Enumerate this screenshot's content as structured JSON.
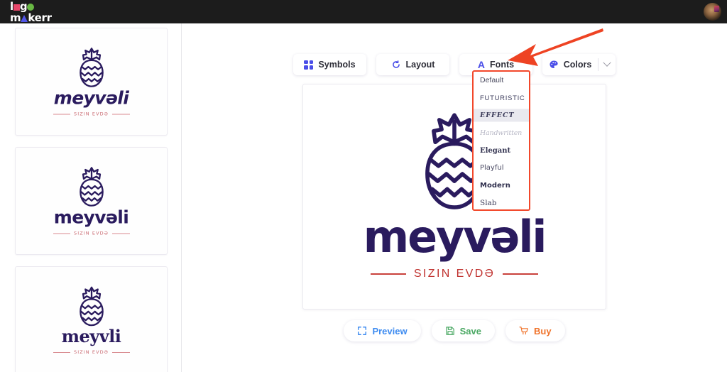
{
  "topbar": {
    "brand_line1_a": "l",
    "brand_line1_sq": "square-icon",
    "brand_line1_b": "g",
    "brand_line1_circle": "circle-icon",
    "brand_line2_a": "m",
    "brand_line2_tri": "triangle-icon",
    "brand_line2_b": "kerr",
    "brand_full": "logomakerr",
    "avatar_name": "user-avatar",
    "background_color": "#1c1c1c"
  },
  "sidebar": {
    "thumbnails": [
      {
        "name": "meyvəli",
        "tagline": "SIZIN EVDƏ",
        "style": "italic",
        "symbol": "pineapple-icon"
      },
      {
        "name": "meyvəli",
        "tagline": "SIZIN EVDƏ",
        "style": "regular",
        "symbol": "pineapple-icon"
      },
      {
        "name": "meyvli",
        "tagline": "SIZIN EVDƏ",
        "style": "serif",
        "symbol": "pineapple-icon"
      }
    ]
  },
  "toolbar": {
    "buttons": [
      {
        "label": "Symbols",
        "icon": "grid-dots-icon",
        "has_caret": false
      },
      {
        "label": "Layout",
        "icon": "layout-refresh-icon",
        "has_caret": false
      },
      {
        "label": "Fonts",
        "icon": "letter-a-icon",
        "has_caret": true,
        "active": true
      },
      {
        "label": "Colors",
        "icon": "palette-icon",
        "has_caret": true
      }
    ],
    "caret_icon": "chevron-down-icon"
  },
  "fonts_dropdown": {
    "open": true,
    "highlight_color": "#f2482b",
    "options": [
      {
        "label": "Default",
        "style_key": "dd-default"
      },
      {
        "label": "FUTURISTIC",
        "style_key": "dd-futuristic"
      },
      {
        "label": "EFFECT",
        "style_key": "dd-effect"
      },
      {
        "label": "Handwritten",
        "style_key": "dd-hand"
      },
      {
        "label": "Elegant",
        "style_key": "dd-elegant"
      },
      {
        "label": "Playful",
        "style_key": "dd-playful"
      },
      {
        "label": "Modern",
        "style_key": "dd-modern"
      },
      {
        "label": "Slab",
        "style_key": "dd-slab"
      }
    ]
  },
  "annotation": {
    "shape": "red-arrow",
    "color": "#ee4323",
    "points_to": "Fonts"
  },
  "canvas": {
    "symbol": "pineapple-icon",
    "name": "meyvəli",
    "tagline": "SIZIN EVDƏ",
    "name_color": "#2a1b5e",
    "tagline_color": "#c0322f"
  },
  "actions": {
    "buttons": [
      {
        "label": "Preview",
        "icon": "expand-icon",
        "color": "#3d8bf0"
      },
      {
        "label": "Save",
        "icon": "floppy-icon",
        "color": "#4aa863"
      },
      {
        "label": "Buy",
        "icon": "cart-icon",
        "color": "#f0732a"
      }
    ]
  }
}
